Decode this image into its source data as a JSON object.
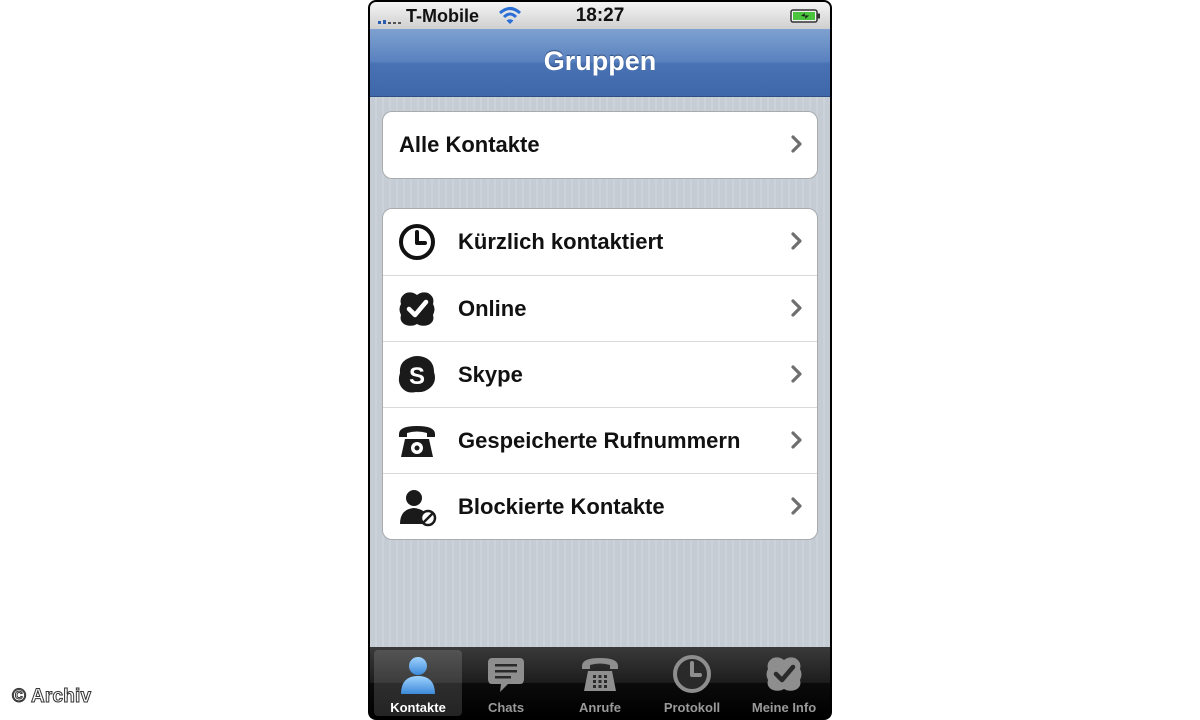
{
  "watermark": "© Archiv",
  "status_bar": {
    "carrier": "T-Mobile",
    "time": "18:27",
    "icons": [
      "signal-icon",
      "wifi-icon",
      "battery-icon"
    ]
  },
  "nav": {
    "title": "Gruppen"
  },
  "groups": {
    "top": [
      {
        "label": "Alle Kontakte"
      }
    ],
    "main": [
      {
        "label": "Kürzlich kontaktiert",
        "icon": "clock-icon"
      },
      {
        "label": "Online",
        "icon": "online-check-icon"
      },
      {
        "label": "Skype",
        "icon": "skype-icon"
      },
      {
        "label": "Gespeicherte Rufnummern",
        "icon": "telephone-icon"
      },
      {
        "label": "Blockierte Kontakte",
        "icon": "blocked-contact-icon"
      }
    ]
  },
  "tabs": [
    {
      "label": "Kontakte",
      "icon": "contact-person-icon",
      "active": true
    },
    {
      "label": "Chats",
      "icon": "chat-bubble-icon",
      "active": false
    },
    {
      "label": "Anrufe",
      "icon": "telephone-icon",
      "active": false
    },
    {
      "label": "Protokoll",
      "icon": "clock-icon",
      "active": false
    },
    {
      "label": "Meine Info",
      "icon": "online-check-icon",
      "active": false
    }
  ],
  "colors": {
    "nav_blue": "#4872b4",
    "tab_active_blue": "#6fb0e8",
    "list_background": "#c5ccd4"
  }
}
